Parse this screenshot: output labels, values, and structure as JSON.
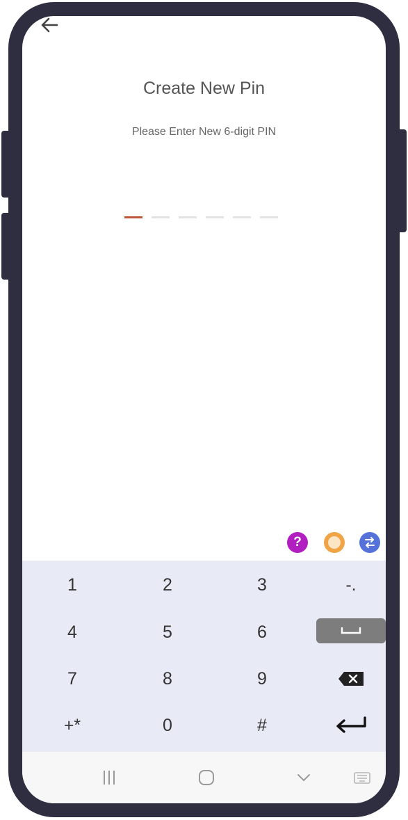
{
  "header": {
    "back_icon": "arrow-left-icon"
  },
  "pin_screen": {
    "title": "Create New Pin",
    "subtitle": "Please Enter New 6-digit PIN",
    "pin_length": 6,
    "entered_digits": 0
  },
  "keyboard_tools": {
    "help_label": "?",
    "help_icon": "help-icon",
    "theme_icon": "palette-icon",
    "switch_icon": "keyboard-switch-icon"
  },
  "keyboard": {
    "rows": [
      [
        "1",
        "2",
        "3",
        "-."
      ],
      [
        "4",
        "5",
        "6",
        "space"
      ],
      [
        "7",
        "8",
        "9",
        "backspace"
      ],
      [
        "+*",
        "0",
        "#",
        "enter"
      ]
    ]
  },
  "navbar": {
    "recents_icon": "recents-icon",
    "home_icon": "home-icon",
    "back_icon": "chevron-down-icon",
    "keyboard_icon": "keyboard-icon"
  },
  "colors": {
    "frame": "#2f2e41",
    "pin_active": "#c0553e",
    "keyboard_bg": "#e8ebf5",
    "help": "#b11fc1",
    "theme": "#f1a445",
    "switch": "#5472d9"
  }
}
